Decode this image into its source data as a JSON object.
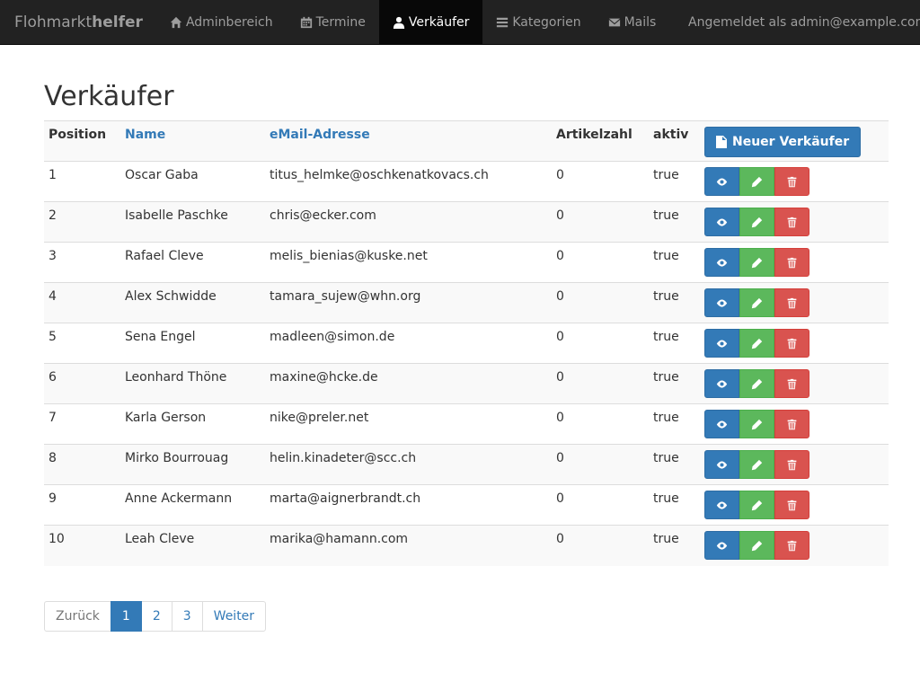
{
  "navbar": {
    "brand_light": "Flohmarkt",
    "brand_bold": "helfer",
    "items": [
      {
        "label": "Adminbereich",
        "icon": "home-icon"
      },
      {
        "label": "Termine",
        "icon": "calendar-icon"
      },
      {
        "label": "Verkäufer",
        "icon": "user-icon",
        "active": true
      },
      {
        "label": "Kategorien",
        "icon": "list-icon"
      },
      {
        "label": "Mails",
        "icon": "envelope-icon"
      }
    ],
    "logged_in": "Angemeldet als admin@example.com"
  },
  "page": {
    "title": "Verkäufer"
  },
  "table": {
    "headers": {
      "position": "Position",
      "name": "Name",
      "email": "eMail-Adresse",
      "articles": "Artikelzahl",
      "active": "aktiv"
    },
    "new_button": "Neuer Verkäufer",
    "rows": [
      {
        "position": "1",
        "name": "Oscar Gaba",
        "email": "titus_helmke@oschkenatkovacs.ch",
        "articles": "0",
        "active": "true"
      },
      {
        "position": "2",
        "name": "Isabelle Paschke",
        "email": "chris@ecker.com",
        "articles": "0",
        "active": "true"
      },
      {
        "position": "3",
        "name": "Rafael Cleve",
        "email": "melis_bienias@kuske.net",
        "articles": "0",
        "active": "true"
      },
      {
        "position": "4",
        "name": "Alex Schwidde",
        "email": "tamara_sujew@whn.org",
        "articles": "0",
        "active": "true"
      },
      {
        "position": "5",
        "name": "Sena Engel",
        "email": "madleen@simon.de",
        "articles": "0",
        "active": "true"
      },
      {
        "position": "6",
        "name": "Leonhard Thöne",
        "email": "maxine@hcke.de",
        "articles": "0",
        "active": "true"
      },
      {
        "position": "7",
        "name": "Karla Gerson",
        "email": "nike@preler.net",
        "articles": "0",
        "active": "true"
      },
      {
        "position": "8",
        "name": "Mirko Bourrouag",
        "email": "helin.kinadeter@scc.ch",
        "articles": "0",
        "active": "true"
      },
      {
        "position": "9",
        "name": "Anne Ackermann",
        "email": "marta@aignerbrandt.ch",
        "articles": "0",
        "active": "true"
      },
      {
        "position": "10",
        "name": "Leah Cleve",
        "email": "marika@hamann.com",
        "articles": "0",
        "active": "true"
      }
    ]
  },
  "pagination": {
    "prev": "Zurück",
    "pages": [
      "1",
      "2",
      "3"
    ],
    "current": "1",
    "next": "Weiter"
  },
  "colors": {
    "primary": "#337ab7",
    "success": "#5cb85c",
    "danger": "#d9534f",
    "navbar": "#222222"
  }
}
